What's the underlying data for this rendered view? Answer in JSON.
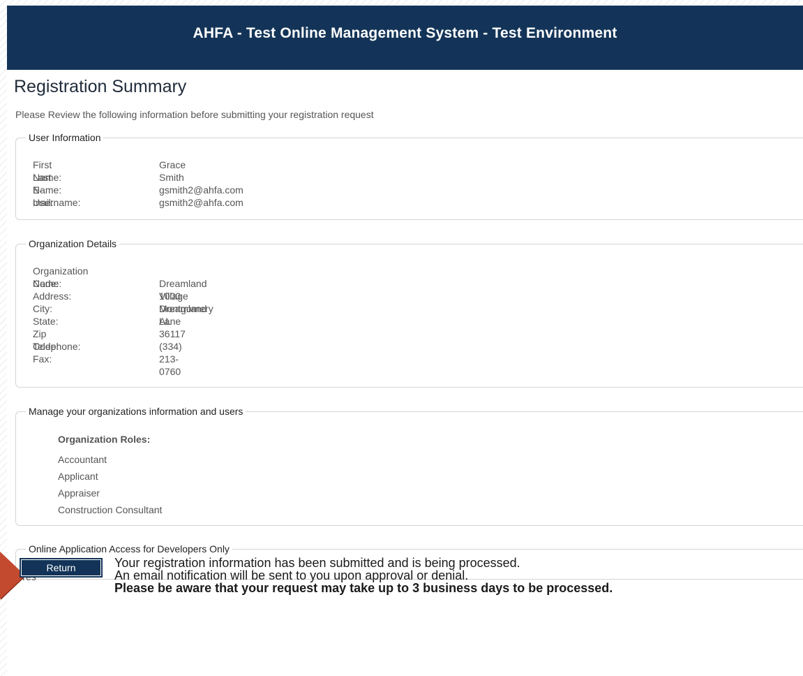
{
  "header": {
    "title": "AHFA - Test Online Management System - Test Environment"
  },
  "page": {
    "title": "Registration Summary",
    "intro": "Please Review the following information before submitting your registration request"
  },
  "user_info": {
    "legend": "User Information",
    "fields": [
      {
        "label": "First Name:",
        "value": "Grace"
      },
      {
        "label": "Last Name:",
        "value": "Smith"
      },
      {
        "label": "E-mail:",
        "value": "gsmith2@ahfa.com"
      },
      {
        "label": "Username:",
        "value": "gsmith2@ahfa.com"
      }
    ]
  },
  "org_details": {
    "legend": "Organization Details",
    "fields": [
      {
        "label": "Organization Code:",
        "value": ""
      },
      {
        "label": "Name:",
        "value": "Dreamland Village"
      },
      {
        "label": "Address:",
        "value": "1000 Dreamland Lane"
      },
      {
        "label": "City:",
        "value": "Montgomery"
      },
      {
        "label": "State:",
        "value": "AL"
      },
      {
        "label": "Zip Code:",
        "value": "36117"
      },
      {
        "label": "Telephone:",
        "value": "(334) 213-0760"
      },
      {
        "label": "Fax:",
        "value": ""
      }
    ]
  },
  "roles": {
    "legend": "Manage your organizations information and users",
    "heading": "Organization Roles:",
    "items": [
      "Accountant",
      "Applicant",
      "Appraiser",
      "Construction Consultant"
    ]
  },
  "dev_access": {
    "legend": "Online Application Access for Developers Only",
    "value": "Yes"
  },
  "footer": {
    "return_label": "Return",
    "message_line1": "Your registration information has been submitted and is being processed.",
    "message_line2": "An email notification will be sent to you upon approval or denial.",
    "message_line3": "Please be aware that your request may take up to 3 business days to be processed."
  },
  "colors": {
    "header_bg": "#133458",
    "arrow": "#c44a2f"
  }
}
